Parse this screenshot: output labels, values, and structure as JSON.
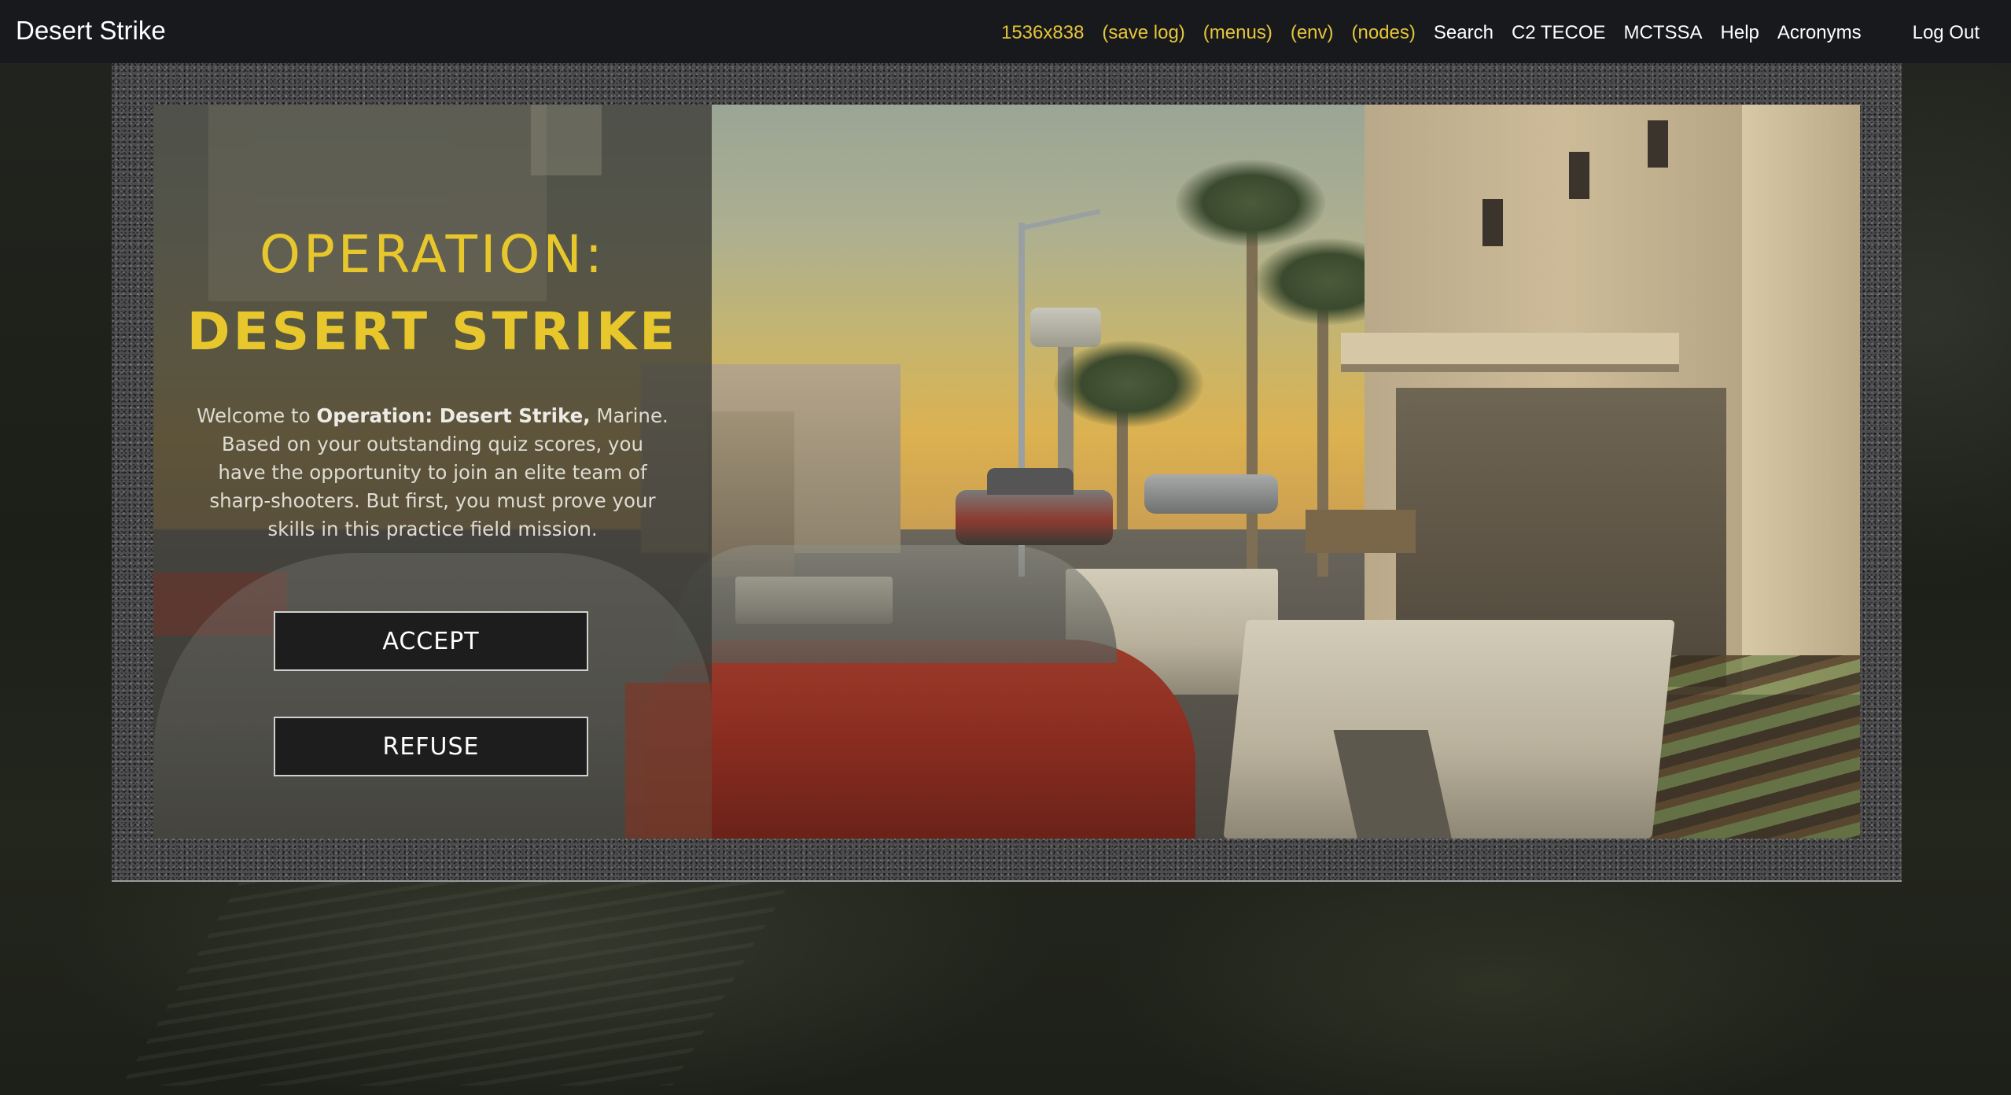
{
  "app": {
    "title": "Desert Strike"
  },
  "nav": {
    "debug_links": [
      {
        "label": "1536x838"
      },
      {
        "label": "(save log)"
      },
      {
        "label": "(menus)"
      },
      {
        "label": "(env)"
      },
      {
        "label": "(nodes)"
      }
    ],
    "links": [
      {
        "label": "Search"
      },
      {
        "label": "C2 TECOE"
      },
      {
        "label": "MCTSSA"
      },
      {
        "label": "Help"
      },
      {
        "label": "Acronyms"
      }
    ],
    "logout": "Log Out"
  },
  "game": {
    "title_line1": "OPERATION:",
    "title_line2": "DESERT STRIKE",
    "intro_prefix": "Welcome to ",
    "intro_bold": "Operation: Desert Strike,",
    "intro_rest": " Marine. Based on your outstanding quiz scores, you have the opportunity to join an elite team of sharp-shooters. But first, you must prove your skills in this practice field mission.",
    "accept_label": "ACCEPT",
    "refuse_label": "REFUSE"
  },
  "colors": {
    "title_yellow": "#e8c72c",
    "debug_link_yellow": "#e6c53a",
    "topbar_bg": "#16181c",
    "button_bg": "#1d1d1d"
  }
}
